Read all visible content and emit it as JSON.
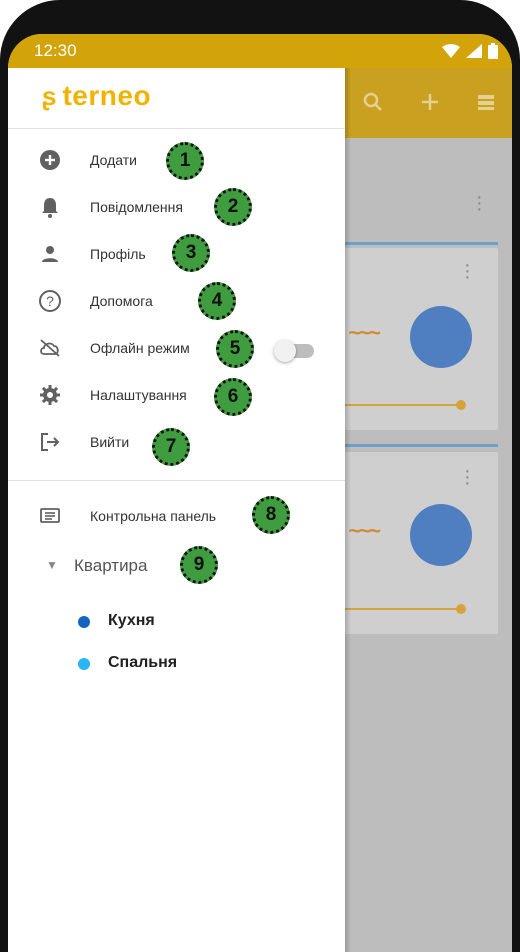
{
  "status_bar": {
    "time": "12:30"
  },
  "app": {
    "logo_text": "terneo"
  },
  "menu": {
    "items": [
      {
        "label": "Додати",
        "icon": "add-circle-icon",
        "badge": "1"
      },
      {
        "label": "Повідомлення",
        "icon": "bell-icon",
        "badge": "2"
      },
      {
        "label": "Профіль",
        "icon": "person-icon",
        "badge": "3"
      },
      {
        "label": "Допомога",
        "icon": "help-circle-icon",
        "badge": "4"
      },
      {
        "label": "Офлайн режим",
        "icon": "cloud-off-icon",
        "badge": "5"
      },
      {
        "label": "Налаштування",
        "icon": "gear-icon",
        "badge": "6"
      },
      {
        "label": "Вийти",
        "icon": "logout-icon",
        "badge": "7"
      }
    ],
    "offline_toggle_on": false
  },
  "dashboard": {
    "label": "Контрольна панель",
    "icon": "dashboard-icon",
    "badge": "8"
  },
  "location": {
    "label": "Квартира",
    "badge": "9",
    "expanded": true,
    "rooms": [
      {
        "label": "Кухня",
        "color": "#1565c0"
      },
      {
        "label": "Спальня",
        "color": "#29b6f6"
      }
    ]
  },
  "colors": {
    "accent": "#f0b400",
    "badge_green": "#3f9d3f"
  }
}
